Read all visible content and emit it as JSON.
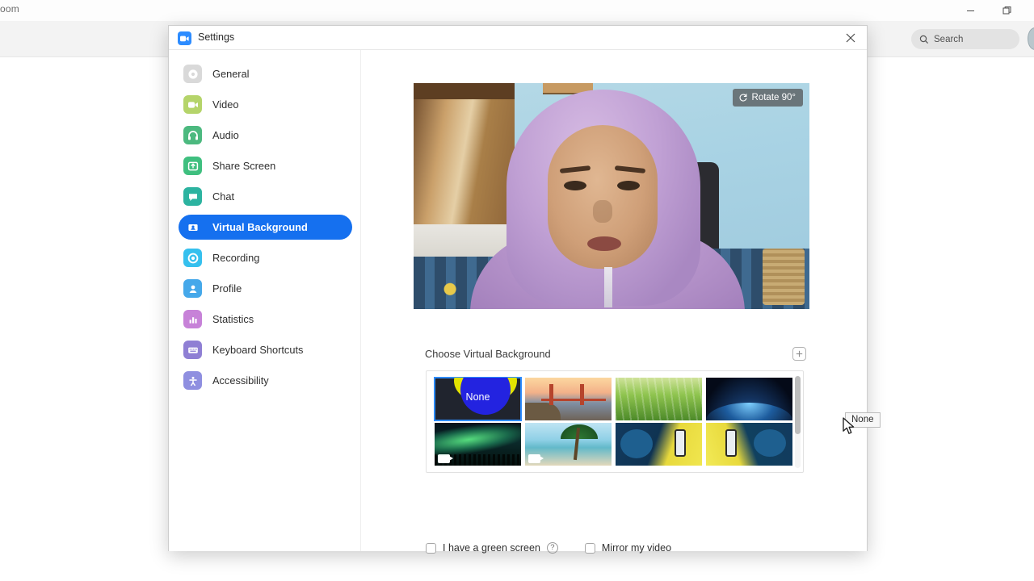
{
  "host": {
    "title": "oom",
    "minimize_icon": "minimize-icon",
    "maximize_icon": "restore-icon",
    "search": {
      "placeholder": "Search",
      "icon": "search-icon"
    }
  },
  "dialog": {
    "title": "Settings",
    "logo_icon": "zoom-logo-icon",
    "close_icon": "close-icon"
  },
  "sidebar": {
    "items": [
      {
        "label": "General",
        "icon": "gear-icon",
        "color": "#d9d9d9",
        "active": false
      },
      {
        "label": "Video",
        "icon": "video-camera-icon",
        "color": "#b5d46a",
        "active": false
      },
      {
        "label": "Audio",
        "icon": "headphones-icon",
        "color": "#4cb97f",
        "active": false
      },
      {
        "label": "Share Screen",
        "icon": "share-screen-icon",
        "color": "#3fbf7f",
        "active": false
      },
      {
        "label": "Chat",
        "icon": "chat-bubble-icon",
        "color": "#2cb3a0",
        "active": false
      },
      {
        "label": "Virtual Background",
        "icon": "person-card-icon",
        "color": "#1570ef",
        "active": true
      },
      {
        "label": "Recording",
        "icon": "record-circle-icon",
        "color": "#35c0ee",
        "active": false
      },
      {
        "label": "Profile",
        "icon": "person-icon",
        "color": "#45a8ea",
        "active": false
      },
      {
        "label": "Statistics",
        "icon": "bar-chart-icon",
        "color": "#c782d8",
        "active": false
      },
      {
        "label": "Keyboard Shortcuts",
        "icon": "keyboard-icon",
        "color": "#8f7fd4",
        "active": false
      },
      {
        "label": "Accessibility",
        "icon": "accessibility-icon",
        "color": "#8f8fe0",
        "active": false
      }
    ]
  },
  "preview": {
    "rotate_button_label": "Rotate 90°",
    "rotate_icon": "rotate-icon"
  },
  "virtual_background": {
    "section_title": "Choose Virtual Background",
    "add_button_icon": "plus-icon",
    "selected_label": "None",
    "tooltip_text": "None",
    "cursor_icon": "mouse-pointer-icon",
    "thumbnails": [
      {
        "name": "None",
        "kind": "none",
        "selected": true,
        "has_video_badge": false
      },
      {
        "name": "Golden Gate Bridge",
        "kind": "bridge",
        "selected": false,
        "has_video_badge": false
      },
      {
        "name": "Grass",
        "kind": "grass",
        "selected": false,
        "has_video_badge": false
      },
      {
        "name": "Earth From Space",
        "kind": "earth",
        "selected": false,
        "has_video_badge": false
      },
      {
        "name": "Aurora",
        "kind": "aurora",
        "selected": false,
        "has_video_badge": true
      },
      {
        "name": "Beach",
        "kind": "beach",
        "selected": false,
        "has_video_badge": true
      },
      {
        "name": "Promo Blue Left",
        "kind": "promo",
        "selected": false,
        "has_video_badge": false
      },
      {
        "name": "Promo Blue Right",
        "kind": "promo2",
        "selected": false,
        "has_video_badge": false
      }
    ],
    "scrollbar": "vertical"
  },
  "options": {
    "green_screen": {
      "label": "I have a green screen",
      "checked": false,
      "help_icon": "question-mark-icon",
      "help_text": "?"
    },
    "mirror_video": {
      "label": "Mirror my video",
      "checked": false
    }
  },
  "colors": {
    "accent": "#1570ef",
    "selection_outline": "#2d8cff",
    "zoom_blue": "#2d8cff"
  }
}
